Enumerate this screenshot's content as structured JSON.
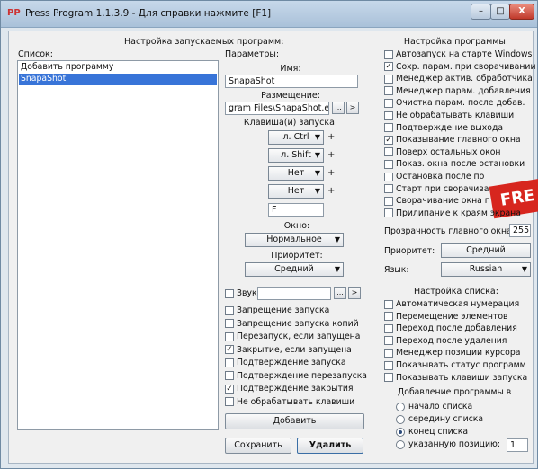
{
  "window": {
    "icon_text": "PP",
    "title": "Press Program 1.1.3.9 - Для справки нажмите [F1]",
    "min": "–",
    "max": "□",
    "close": "X"
  },
  "left_panel": {
    "header": "Настройка запускаемых программ:",
    "list_caption": "Список:",
    "list_items": [
      "Добавить программу",
      "SnapaShot"
    ],
    "selected_index": 1
  },
  "params": {
    "caption": "Параметры:",
    "name_label": "Имя:",
    "name_value": "SnapaShot",
    "location_label": "Размещение:",
    "location_value": "gram Files\\SnapaShot.exe",
    "browse1": "...",
    "browse2": ">",
    "hotkeys_label": "Клавиша(и) запуска:",
    "hotkeys": [
      "л. Ctrl",
      "л. Shift",
      "Нет",
      "Нет"
    ],
    "plus": "+",
    "hotkey_char": "F",
    "window_label": "Окно:",
    "window_value": "Нормальное",
    "priority_label": "Приоритет:",
    "priority_value": "Средний",
    "dropdown_arrow": "▼",
    "sound_label": "Звук:",
    "sound_browse1": "...",
    "sound_browse2": ">",
    "check_icon": "✓",
    "options": [
      {
        "label": "Запрещение запуска",
        "checked": false
      },
      {
        "label": "Запрещение запуска копий",
        "checked": false
      },
      {
        "label": "Перезапуск, если запущена",
        "checked": false
      },
      {
        "label": "Закрытие, если запущена",
        "checked": true
      },
      {
        "label": "Подтверждение запуска",
        "checked": false
      },
      {
        "label": "Подтверждение перезапуска",
        "checked": false
      },
      {
        "label": "Подтверждение закрытия",
        "checked": true
      },
      {
        "label": "Не обрабатывать клавиши",
        "checked": false
      }
    ],
    "add_button": "Добавить",
    "save_button": "Сохранить",
    "delete_button": "Удалить"
  },
  "settings": {
    "header": "Настройка программы:",
    "items": [
      {
        "label": "Автозапуск на старте Windows",
        "checked": false
      },
      {
        "label": "Сохр. парам. при сворачивании",
        "checked": true
      },
      {
        "label": "Менеджер актив. обработчика",
        "checked": false
      },
      {
        "label": "Менеджер парам. добавления",
        "checked": false
      },
      {
        "label": "Очистка парам. после добав.",
        "checked": false
      },
      {
        "label": "Не обрабатывать клавиши",
        "checked": false
      },
      {
        "label": "Подтверждение выхода",
        "checked": false
      },
      {
        "label": "Показывание главного окна",
        "checked": true
      },
      {
        "label": "Поверх остальных окон",
        "checked": false
      },
      {
        "label": "Показ. окна после остановки",
        "checked": false
      },
      {
        "label": "Остановка после по",
        "checked": false
      },
      {
        "label": "Старт при сворачива",
        "checked": false
      },
      {
        "label": "Сворачивание окна п",
        "checked": false
      },
      {
        "label": "Прилипание к краям экрана",
        "checked": false
      }
    ],
    "transparency_label": "Прозрачность главного окна:",
    "transparency_value": "255",
    "priority_label": "Приоритет:",
    "priority_value": "Средний",
    "language_label": "Язык:",
    "language_value": "Russian"
  },
  "list_settings": {
    "header": "Настройка списка:",
    "items": [
      {
        "label": "Автоматическая нумерация",
        "checked": false
      },
      {
        "label": "Перемещение элементов",
        "checked": false
      },
      {
        "label": "Переход после добавления",
        "checked": false
      },
      {
        "label": "Переход после удаления",
        "checked": false
      },
      {
        "label": "Менеджер позиции курсора",
        "checked": false
      },
      {
        "label": "Показывать статус программ",
        "checked": false
      },
      {
        "label": "Показывать клавиши запуска",
        "checked": false
      }
    ],
    "add_pos_label": "Добавление программы в",
    "radios": [
      {
        "label": "начало списка",
        "selected": false
      },
      {
        "label": "середину списка",
        "selected": false
      },
      {
        "label": "конец списка",
        "selected": true
      },
      {
        "label": "указанную позицию:",
        "selected": false
      }
    ],
    "position_value": "1"
  },
  "promo_text": "FRE"
}
